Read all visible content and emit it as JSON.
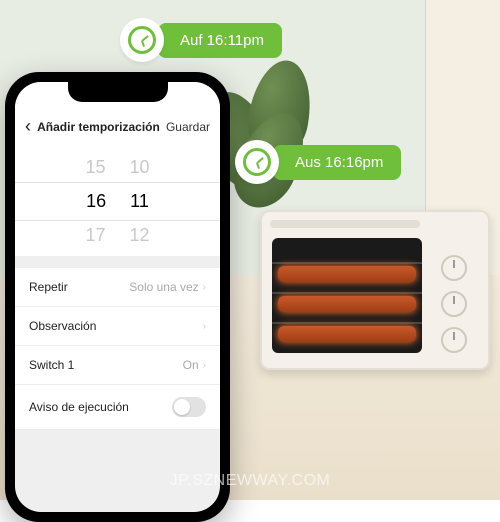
{
  "bubbles": {
    "on": "Auf 16:11pm",
    "off": "Aus 16:16pm"
  },
  "phone": {
    "nav": {
      "back": "‹",
      "title": "Añadir temporización",
      "save": "Guardar"
    },
    "picker": {
      "prev_h": "15",
      "prev_m": "10",
      "sel_h": "16",
      "sel_m": "11",
      "next_h": "17",
      "next_m": "12"
    },
    "rows": {
      "repeat_label": "Repetir",
      "repeat_value": "Solo una vez",
      "note_label": "Observación",
      "note_value": "",
      "switch_label": "Switch 1",
      "switch_value": "On",
      "exec_label": "Aviso de ejecución"
    }
  },
  "watermark": "JP.SZNEWWAY.COM"
}
